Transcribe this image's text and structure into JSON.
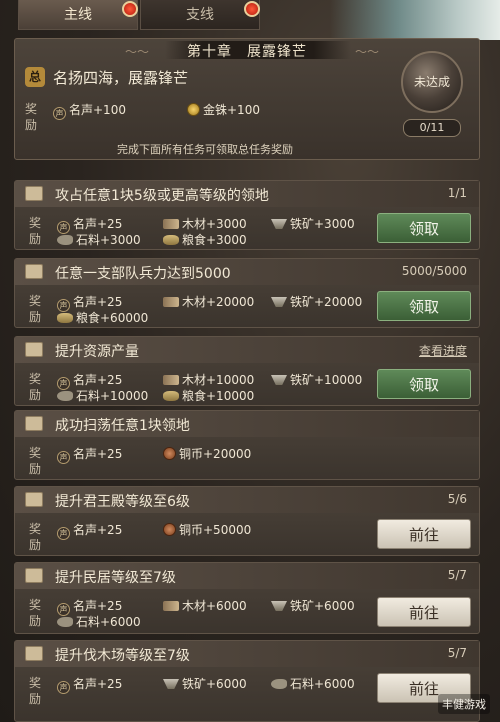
{
  "tabs": {
    "main": "主线",
    "side": "支线"
  },
  "chapter": {
    "title": "第十章　展露锋芒",
    "badge": "总",
    "name": "名扬四海，展露锋芒",
    "reward_label_1": "奖",
    "reward_label_2": "励",
    "reward_fame": "名声+100",
    "reward_gold": "金铢+100",
    "status": "未达成",
    "progress": "0/11",
    "note": "完成下面所有任务可领取总任务奖励"
  },
  "reward_label": {
    "a": "奖",
    "b": "励"
  },
  "tasks": [
    {
      "title": "攻占任意1块5级或更高等级的领地",
      "progress": "1/1",
      "r1": "名声+25",
      "r2": "木材+3000",
      "r3": "铁矿+3000",
      "r4": "石料+3000",
      "r5": "粮食+3000",
      "button": "领取"
    },
    {
      "title": "任意一支部队兵力达到5000",
      "progress": "5000/5000",
      "r1": "名声+25",
      "r2": "木材+20000",
      "r3": "铁矿+20000",
      "r4": "粮食+60000",
      "button": "领取"
    },
    {
      "title": "提升资源产量",
      "link": "查看进度",
      "r1": "名声+25",
      "r2": "木材+10000",
      "r3": "铁矿+10000",
      "r4": "石料+10000",
      "r5": "粮食+10000",
      "button": "领取"
    },
    {
      "title": "成功扫荡任意1块领地",
      "r1": "名声+25",
      "r2": "铜币+20000"
    },
    {
      "title": "提升君王殿等级至6级",
      "progress": "5/6",
      "r1": "名声+25",
      "r2": "铜币+50000",
      "button": "前往"
    },
    {
      "title": "提升民居等级至7级",
      "progress": "5/7",
      "r1": "名声+25",
      "r2": "木材+6000",
      "r3": "铁矿+6000",
      "r4": "石料+6000",
      "button": "前往"
    },
    {
      "title": "提升伐木场等级至7级",
      "progress": "5/7",
      "r1": "名声+25",
      "r2": "铁矿+6000",
      "r3": "石料+6000",
      "button": "前往"
    }
  ],
  "icons": {
    "fame": "声"
  },
  "watermark": "丰健游戏"
}
